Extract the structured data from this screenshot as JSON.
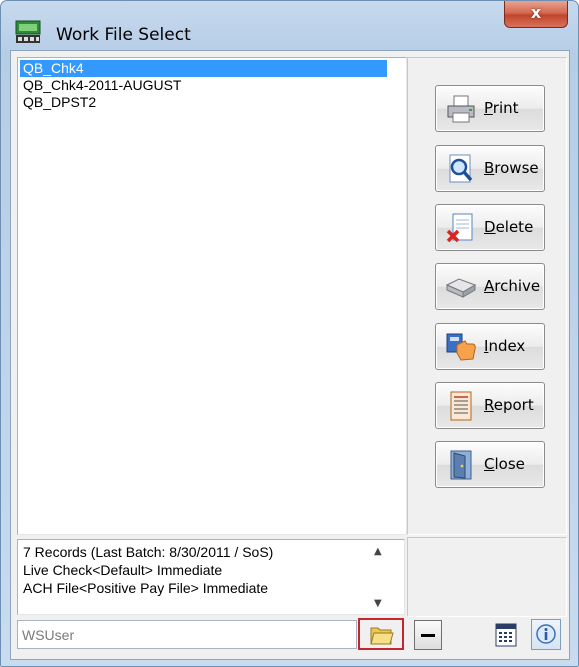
{
  "window": {
    "title": "Work File Select",
    "close_label": "x"
  },
  "files": [
    "QB_Chk4",
    "QB_Chk4-2011-AUGUST",
    "QB_DPST2"
  ],
  "buttons": [
    {
      "name": "print",
      "label": "Print",
      "mnemonic": "P",
      "rest": "rint",
      "icon": "printer-icon"
    },
    {
      "name": "browse",
      "label": "Browse",
      "mnemonic": "B",
      "rest": "rowse",
      "icon": "magnifier-document-icon"
    },
    {
      "name": "delete",
      "label": "Delete",
      "mnemonic": "D",
      "rest": "elete",
      "icon": "delete-document-icon"
    },
    {
      "name": "archive",
      "label": "Archive",
      "mnemonic": "A",
      "rest": "rchive",
      "icon": "archive-drive-icon"
    },
    {
      "name": "index",
      "label": "Index",
      "mnemonic": "I",
      "rest": "ndex",
      "icon": "index-hand-icon"
    },
    {
      "name": "report",
      "label": "Report",
      "mnemonic": "R",
      "rest": "eport",
      "icon": "report-icon"
    },
    {
      "name": "close",
      "label": "Close",
      "mnemonic": "C",
      "rest": "lose",
      "icon": "door-exit-icon"
    }
  ],
  "status": {
    "lines": [
      "7 Records (Last Batch: 8/30/2011 / SoS)",
      "Live Check<Default> Immediate",
      "ACH File<Positive Pay File> Immediate"
    ]
  },
  "user_field": {
    "value": "WSUser"
  },
  "colors": {
    "selection": "#3399ff",
    "highlight_border": "#c4262e",
    "close_button": "#c0452d"
  }
}
